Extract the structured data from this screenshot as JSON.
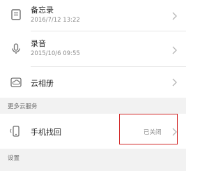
{
  "memo": {
    "title": "备忘录",
    "date": "2016/7/12 13:22",
    "icon": "memo-icon"
  },
  "recorder": {
    "title": "录音",
    "date": "2015/10/6 09:55",
    "icon": "microphone-icon"
  },
  "cloud_album": {
    "title": "云相册",
    "icon": "cloud-album-icon"
  },
  "more_services": {
    "label": "更多云服务"
  },
  "find_phone": {
    "title": "手机找回",
    "status": "已关闭",
    "icon": "find-phone-icon"
  },
  "settings": {
    "label": "设置"
  },
  "colors": {
    "highlight": "#d22a2a",
    "section_bg": "#f2f2f2",
    "icon": "#6f6f6f"
  }
}
